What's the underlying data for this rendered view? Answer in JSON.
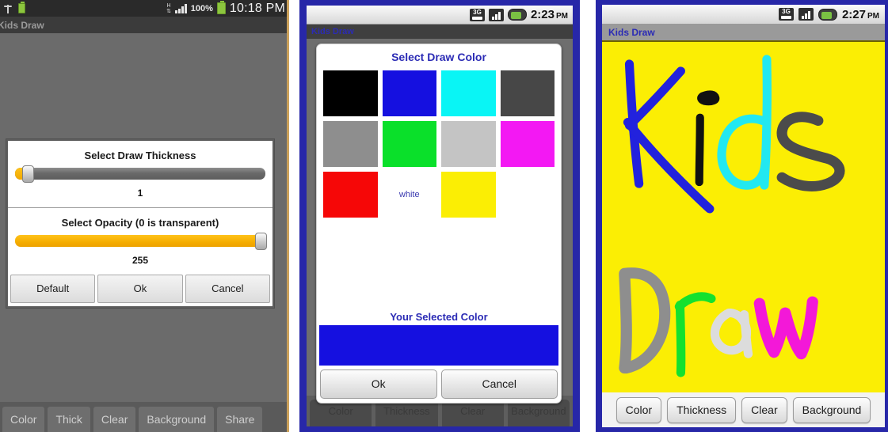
{
  "panel1": {
    "statusbar": {
      "usb_icon": "usb-icon",
      "battery_small_icon": "battery-icon",
      "network_icon": "h-plus-network-icon",
      "signal_icon": "signal-bars-icon",
      "battery_percent": "100%",
      "battery_icon": "battery-icon",
      "clock": "10:18 PM"
    },
    "app_title": "Kids Draw",
    "dialog": {
      "thickness_label": "Select Draw Thickness",
      "thickness_value": "1",
      "opacity_label": "Select Opacity (0 is transparent)",
      "opacity_value": "255",
      "buttons": [
        "Default",
        "Ok",
        "Cancel"
      ]
    },
    "toolbar": [
      "Color",
      "Thick",
      "Clear",
      "Background",
      "Share"
    ]
  },
  "panel2": {
    "statusbar": {
      "data_icon": "3g-icon",
      "signal_icon": "signal-bars-icon",
      "battery_icon": "battery-icon",
      "clock_time": "2:23",
      "clock_ampm": "PM"
    },
    "app_title": "Kids Draw",
    "dialog": {
      "title": "Select Draw Color",
      "swatches": [
        {
          "name": "black",
          "hex": "#000000",
          "label": ""
        },
        {
          "name": "blue",
          "hex": "#1510e0",
          "label": ""
        },
        {
          "name": "cyan",
          "hex": "#09f5f5",
          "label": ""
        },
        {
          "name": "darkgray",
          "hex": "#474747",
          "label": ""
        },
        {
          "name": "gray",
          "hex": "#8e8e8e",
          "label": ""
        },
        {
          "name": "green",
          "hex": "#0ae02a",
          "label": ""
        },
        {
          "name": "lightgray",
          "hex": "#c4c4c4",
          "label": ""
        },
        {
          "name": "magenta",
          "hex": "#f318f3",
          "label": ""
        },
        {
          "name": "red",
          "hex": "#f60707",
          "label": ""
        },
        {
          "name": "white",
          "hex": "#ffffff",
          "label": "white"
        },
        {
          "name": "yellow",
          "hex": "#fbee04",
          "label": ""
        }
      ],
      "selected_label": "Your Selected Color",
      "selected_hex": "#1510e0",
      "buttons": [
        "Ok",
        "Cancel"
      ]
    },
    "toolbar": [
      "Color",
      "Thickness",
      "Clear",
      "Background"
    ]
  },
  "panel3": {
    "statusbar": {
      "data_icon": "3g-icon",
      "signal_icon": "signal-bars-icon",
      "battery_icon": "battery-icon",
      "clock_time": "2:27",
      "clock_ampm": "PM"
    },
    "app_title": "Kids Draw",
    "canvas": {
      "background_hex": "#fbee04",
      "drawing_text": "Kids Draw",
      "strokes": [
        {
          "char": "K",
          "color": "#2222dd"
        },
        {
          "char": "i",
          "color": "#111111"
        },
        {
          "char": "d",
          "color": "#22e8f0"
        },
        {
          "char": "s",
          "color": "#4b4b4b"
        },
        {
          "char": "D",
          "color": "#8e8e8e"
        },
        {
          "char": "r",
          "color": "#14e12e"
        },
        {
          "char": "a",
          "color": "#dcdcdc"
        },
        {
          "char": "w",
          "color": "#f318d8"
        }
      ]
    },
    "toolbar": [
      "Color",
      "Thickness",
      "Clear",
      "Background"
    ]
  }
}
